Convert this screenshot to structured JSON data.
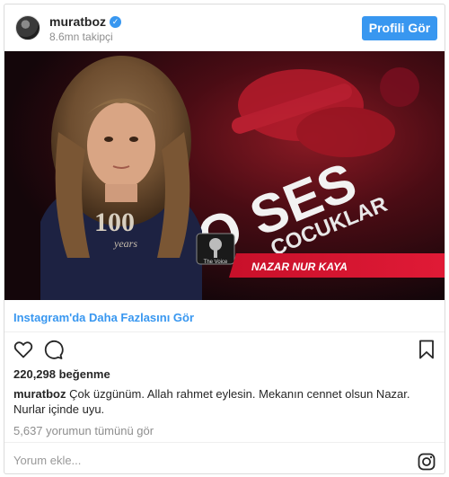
{
  "header": {
    "username": "muratboz",
    "followers": "8.6mn takipçi",
    "profile_button": "Profili Gör",
    "verified_mark": "✓"
  },
  "photo": {
    "name_banner": "NAZAR NUR KAYA",
    "logo_text": "O SES",
    "logo_sub": "ÇOCUKLAR",
    "shirt_text": "100",
    "shirt_sub": "years",
    "badge": "The Voice",
    "accent_color": "#d0102a"
  },
  "more_link": "Instagram'da Daha Fazlasını Gör",
  "actions": {
    "like_icon": "heart-icon",
    "comment_icon": "comment-bubble-icon",
    "save_icon": "bookmark-icon"
  },
  "likes": "220,298 beğenme",
  "caption": {
    "user": "muratboz",
    "text": "Çok üzgünüm. Allah rahmet eylesin. Mekanın cennet olsun Nazar. Nurlar içinde uyu."
  },
  "comments_link": "5,637 yorumun tümünü gör",
  "comment_placeholder": "Yorum ekle...",
  "footer_icon": "instagram-icon",
  "colors": {
    "accent": "#3897f0",
    "text": "#262626",
    "muted": "#8e8e8e",
    "border": "#dbdbdb"
  }
}
